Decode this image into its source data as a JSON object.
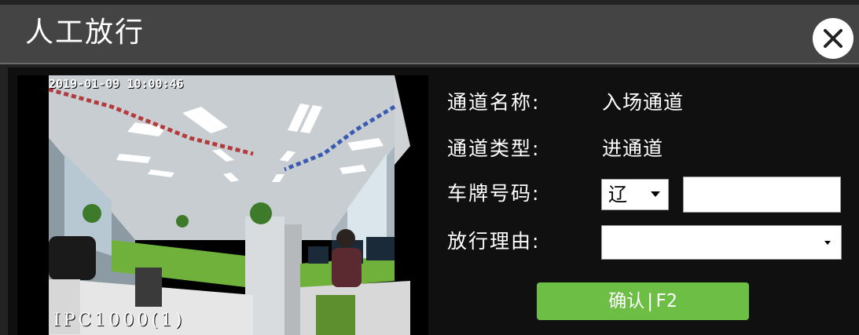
{
  "dialog": {
    "title": "人工放行",
    "close_icon": "close-icon"
  },
  "video": {
    "timestamp": "2019-01-09 10:00:46",
    "camera_name": "IPC1000(1)"
  },
  "form": {
    "channel_name_label": "通道名称:",
    "channel_name_value": "入场通道",
    "channel_type_label": "通道类型:",
    "channel_type_value": "进通道",
    "plate_label": "车牌号码:",
    "plate_province": "辽",
    "plate_number": "",
    "reason_label": "放行理由:",
    "reason_value": ""
  },
  "actions": {
    "confirm_label": "确认|F2"
  },
  "colors": {
    "title_bar": "#444444",
    "confirm_button": "#6cbe45"
  }
}
